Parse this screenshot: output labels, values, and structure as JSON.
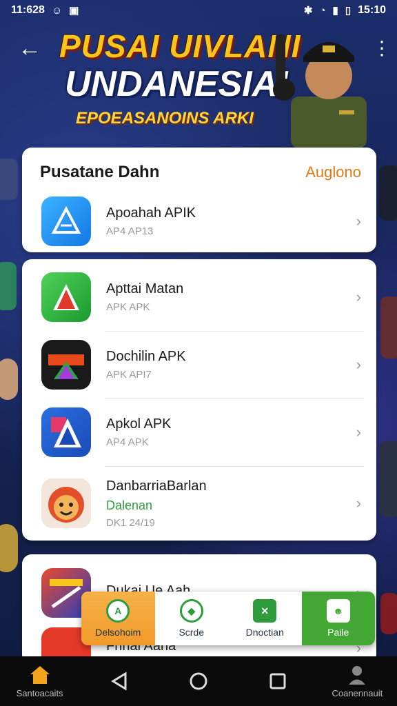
{
  "status_bar": {
    "time": "11:628",
    "clock": "15:10"
  },
  "banner": {
    "title": "PUSAI UIVLANI",
    "subtitle": "UNDANESIAI",
    "tagline": "EPOEASANOINS ARKI"
  },
  "featured": {
    "title": "Pusatane Dahn",
    "link": "Auglono",
    "apps": [
      {
        "name": "Apoahah APIK",
        "sub": "AP4 AP13",
        "icon": "blue-a-icon"
      }
    ]
  },
  "list": {
    "apps": [
      {
        "name": "Apttai Matan",
        "sub": "APK APK",
        "icon": "green-a-icon"
      },
      {
        "name": "Dochilin APK",
        "sub": "APK API7",
        "icon": "nioca-icon"
      },
      {
        "name": "Apkol APK",
        "sub": "AP4 APK",
        "icon": "colorful-a-icon"
      },
      {
        "name": "DanbarriaBarlan",
        "sub_green": "Dalenan",
        "sub": "DK1 24/19",
        "icon": "mascot-icon"
      }
    ]
  },
  "third": {
    "apps": [
      {
        "name": "Dukai Ue Aah",
        "icon": "game-art-icon"
      },
      {
        "name": "Fnnal Aaha",
        "icon": "red-circle-icon"
      }
    ]
  },
  "tabs": [
    {
      "label": "Delsohoim",
      "icon": "a-circle-icon"
    },
    {
      "label": "Scrde",
      "icon": "shield-icon"
    },
    {
      "label": "Dnoctian",
      "icon": "chart-icon"
    },
    {
      "label": "Paile",
      "icon": "people-icon"
    }
  ],
  "nav": {
    "home_label": "Santoacaits",
    "profile_label": "Coanennauit"
  },
  "colors": {
    "accent_orange": "#e07a15",
    "green": "#43a833",
    "background": "#1b2d6b"
  }
}
